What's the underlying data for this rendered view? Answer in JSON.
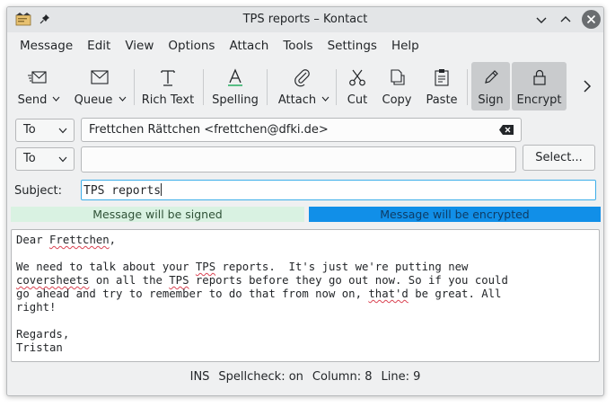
{
  "window": {
    "title": "TPS reports – Kontact"
  },
  "menu": [
    "Message",
    "Edit",
    "View",
    "Options",
    "Attach",
    "Tools",
    "Settings",
    "Help"
  ],
  "toolbar": {
    "send": "Send",
    "queue": "Queue",
    "rich_text": "Rich Text",
    "spelling": "Spelling",
    "attach": "Attach",
    "cut": "Cut",
    "copy": "Copy",
    "paste": "Paste",
    "sign": "Sign",
    "encrypt": "Encrypt"
  },
  "recipients": [
    {
      "type": "To",
      "value": "Frettchen Rättchen <frettchen@dfki.de>"
    },
    {
      "type": "To",
      "value": ""
    }
  ],
  "select_button": "Select...",
  "subject": {
    "label": "Subject:",
    "value": "TPS reports"
  },
  "banners": {
    "signed": "Message will be signed",
    "encrypted": "Message will be encrypted"
  },
  "body": {
    "line1_a": "Dear ",
    "line1_b": "Frettchen",
    "line1_c": ",",
    "line3_a": "We need to talk about your ",
    "line3_b": "TPS",
    "line3_c": " reports.  It's just we're putting new",
    "line4_a": "coversheets",
    "line4_b": " on all the ",
    "line4_c": "TPS",
    "line4_d": " reports before they go out now. So if you could",
    "line5_a": "go ahead and try to remember to do that from now on, ",
    "line5_b": "that'd",
    "line5_c": " be great. All",
    "line6": "right!",
    "line8": "Regards,",
    "line9": "Tristan"
  },
  "status": {
    "mode": "INS",
    "spellcheck": "Spellcheck: on",
    "column": "Column: 8",
    "line": "Line: 9"
  },
  "colors": {
    "accent": "#3daee9",
    "signed_bg": "#d9f2e2",
    "encrypted_bg": "#118fe8",
    "misspelled": "#da4453"
  },
  "icons": [
    "app-icon",
    "pin-icon",
    "minimize-icon",
    "maximize-icon",
    "close-icon",
    "send-icon",
    "queue-icon",
    "rich-text-icon",
    "spelling-icon",
    "attach-icon",
    "cut-icon",
    "copy-icon",
    "paste-icon",
    "sign-icon",
    "encrypt-icon",
    "chevron-right-icon",
    "clear-icon"
  ]
}
